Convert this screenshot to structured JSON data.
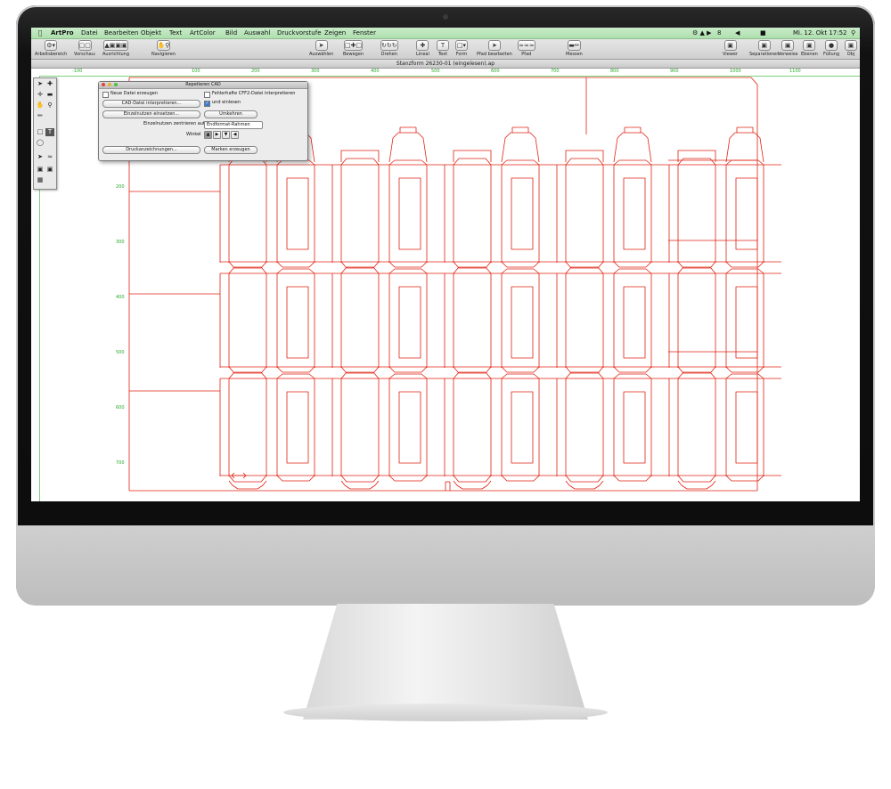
{
  "menubar": {
    "app_name": "ArtPro",
    "items": [
      "Datei",
      "Bearbeiten",
      "Objekt",
      "Text",
      "ArtColor",
      "Bild",
      "Auswahl",
      "Druckvorstufe",
      "Zeigen",
      "Fenster"
    ],
    "status": {
      "battery": "8",
      "clock": "Mi. 12. Okt 17:52"
    }
  },
  "toolbar": {
    "left": [
      "Arbeitsbereich",
      "Vorschau:",
      "Ausrichtung",
      "Navigieren"
    ],
    "center": [
      "Auswählen",
      "Bewegen",
      "Drehen",
      "Lineal",
      "Text",
      "Form",
      "Pfad bearbeiten",
      "Pfad",
      "Messen"
    ],
    "right": [
      "Viewer",
      "Separationen",
      "Verweise",
      "Ebenen",
      "Füllung",
      "Obj"
    ]
  },
  "document": {
    "title": "Stanzform 26230-01 (eingelesen).ap"
  },
  "rulers": {
    "h": [
      "-100",
      "100",
      "200",
      "300",
      "400",
      "500",
      "600",
      "700",
      "800",
      "900",
      "1000",
      "1100"
    ],
    "v": [
      "200",
      "300",
      "400",
      "500",
      "600",
      "700"
    ]
  },
  "dialog": {
    "title": "Repetieren CAD",
    "new_file_label": "Neue Datei erzeugen",
    "faulty_cff2_label": "Fehlerhafte CFF2-Datei interpretieren",
    "cad_button": "CAD-Datei interpretieren...",
    "and_read_label": "und einlesen",
    "insert_button": "Einzelnutzen einsetzen...",
    "reverse_button": "Umkehren",
    "center_label": "Einzelnutzen zentrieren auf:",
    "center_value": "Endformat-Rahmen",
    "angle_label": "Winkel",
    "print_button": "Druckanzeichnungen...",
    "marks_button": "Marken erzeugen"
  },
  "colors": {
    "dieline": "#e02010",
    "ruler": "#2aa82a",
    "menubar": "#b8e6b8"
  }
}
